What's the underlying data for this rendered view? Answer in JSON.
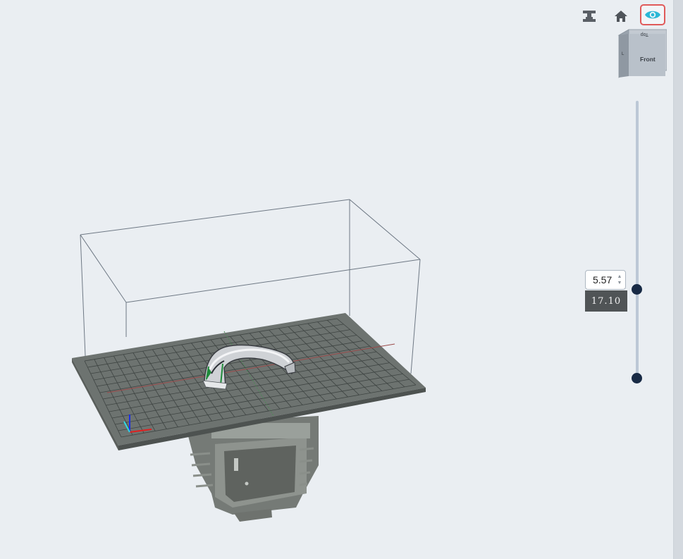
{
  "toolbar": {
    "support_icon": "support-structure-icon",
    "home_icon": "home-icon",
    "eye_icon": "eye-icon",
    "accent": "#2bb7d6",
    "active_border": "#e05a5a"
  },
  "view_cube": {
    "top_label": "Top",
    "front_label": "Front",
    "left_label": "L"
  },
  "layer_slider": {
    "input_value": "5.57",
    "height_label": "17.10",
    "spin_up": "▲",
    "spin_down": "▼",
    "track_color": "#bcc8d6",
    "handle_color": "#182a45"
  }
}
